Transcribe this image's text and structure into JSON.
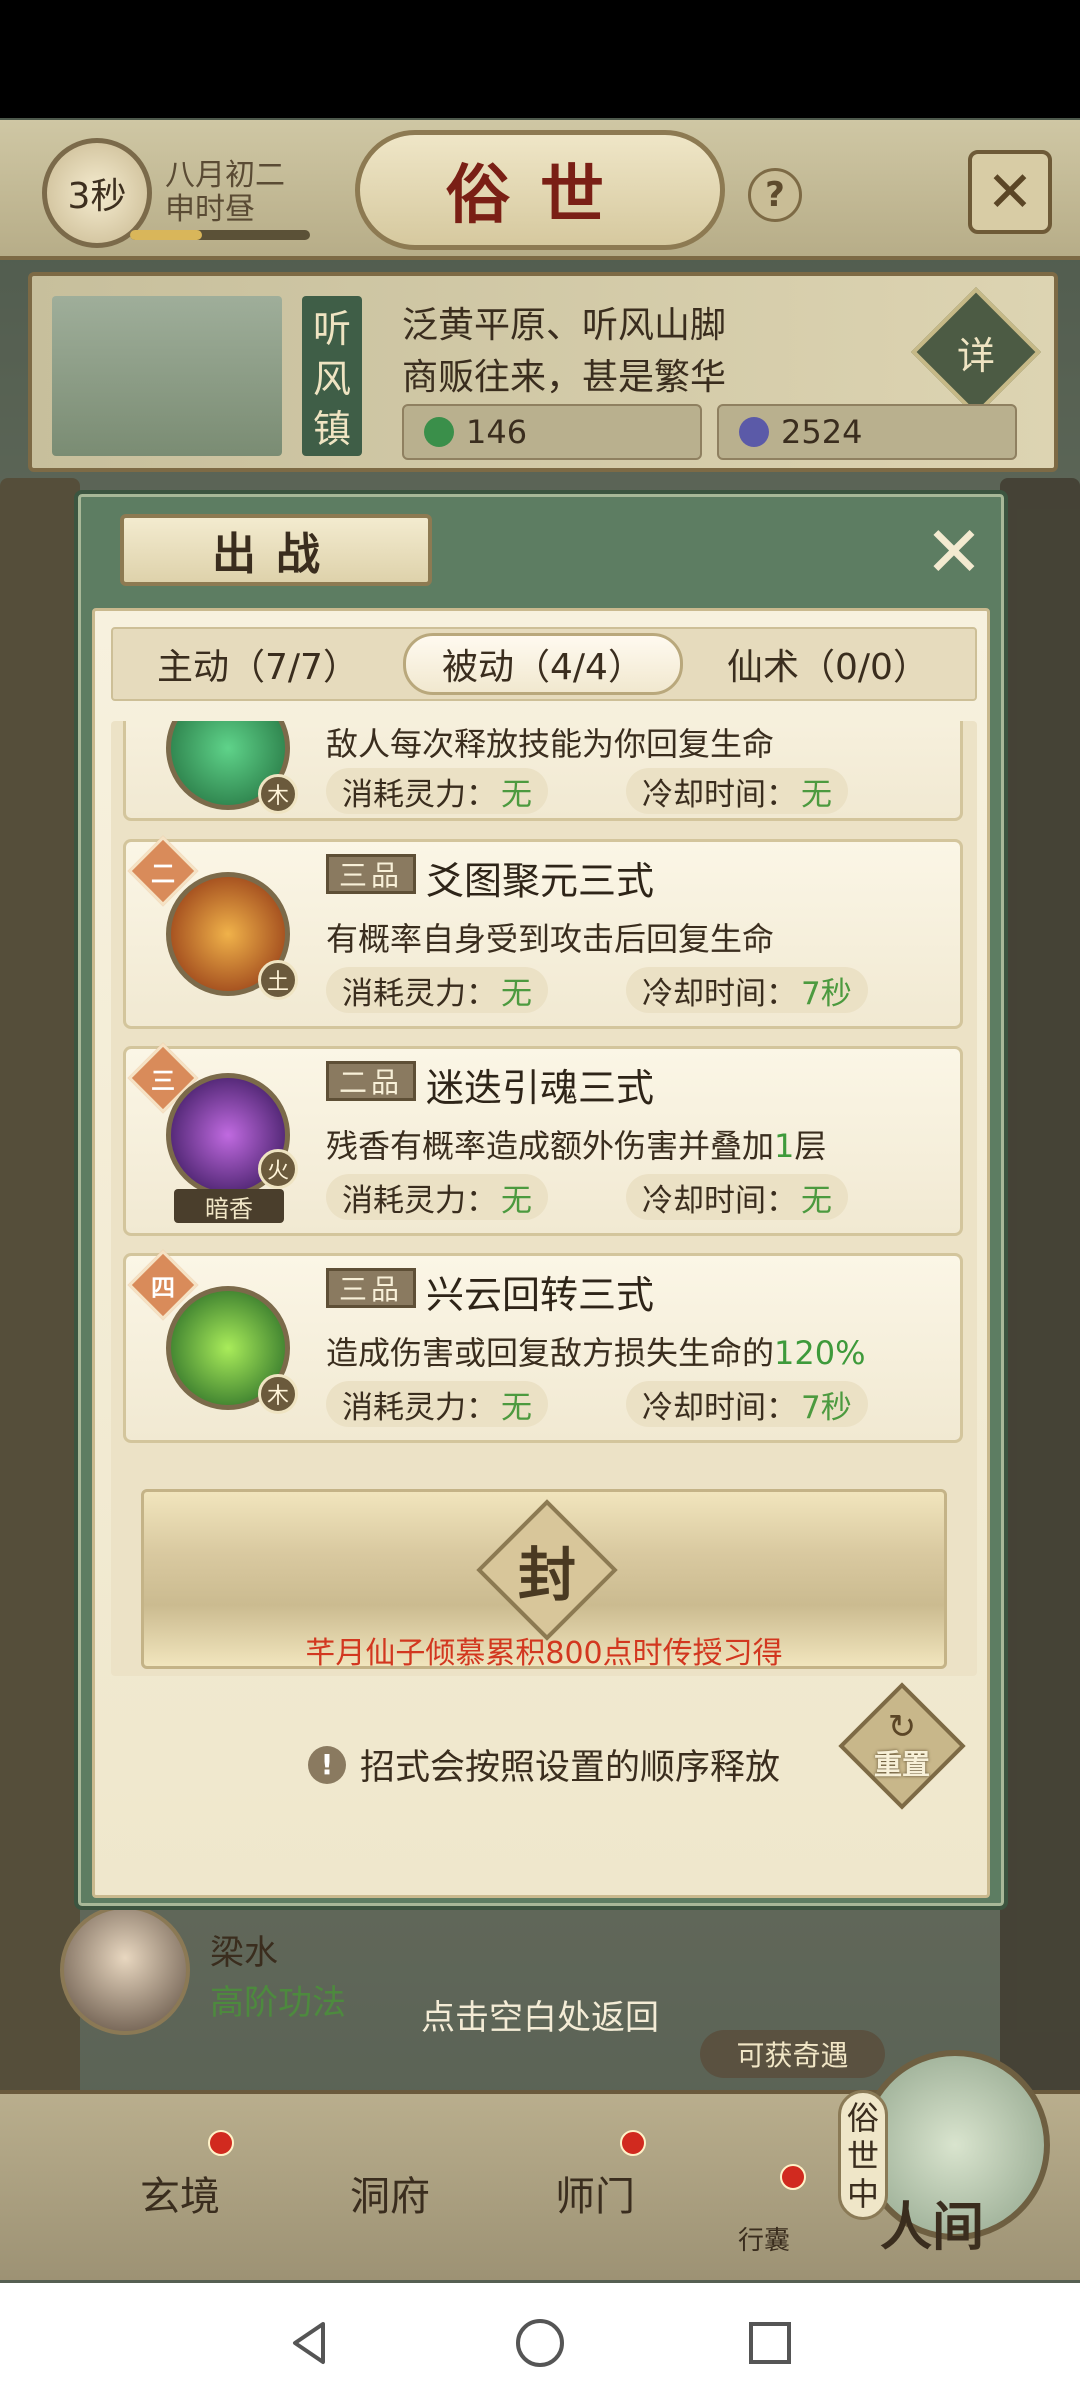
{
  "topbar": {
    "timer": "3秒",
    "date_line1": "八月初二",
    "date_line2": "申时昼",
    "title": "俗世",
    "help": "?",
    "close": "✕"
  },
  "location": {
    "tag": "听风镇",
    "desc_line1": "泛黄平原、听风山脚",
    "desc_line2": "商贩往来，甚是繁华",
    "detail_button": "详",
    "resource1": "146",
    "resource2": "2524"
  },
  "modal": {
    "title": "出战",
    "close": "✕",
    "tabs": [
      {
        "label": "主动（7/7）"
      },
      {
        "label": "被动（4/4）"
      },
      {
        "label": "仙术（0/0）"
      }
    ],
    "stat_labels": {
      "cost": "消耗灵力：",
      "cooldown": "冷却时间："
    },
    "skills": [
      {
        "order": "",
        "grade": "",
        "name": "",
        "desc": "敌人每次释放技能为你回复生命",
        "element": "木",
        "cost": "无",
        "cooldown": "无"
      },
      {
        "order": "二",
        "grade": "三品",
        "name": "爻图聚元三式",
        "desc": "有概率自身受到攻击后回复生命",
        "element": "土",
        "cost": "无",
        "cooldown": "7秒"
      },
      {
        "order": "三",
        "grade": "二品",
        "name": "迷迭引魂三式",
        "desc_prefix": "残香有概率造成额外伤害并叠加",
        "desc_highlight": "1",
        "desc_suffix": "层",
        "element": "火",
        "icon_caption": "暗香",
        "cost": "无",
        "cooldown": "无"
      },
      {
        "order": "四",
        "grade": "三品",
        "name": "兴云回转三式",
        "desc_prefix": "造成伤害或回复敌方损失生命的",
        "desc_highlight": "120%",
        "element": "木",
        "cost": "无",
        "cooldown": "7秒"
      }
    ],
    "sealed": {
      "char": "封",
      "text": "芊月仙子倾慕累积800点时传授习得"
    },
    "hint": "招式会按照设置的顺序释放",
    "hint_icon": "!",
    "reset_label": "重置"
  },
  "background": {
    "char_name": "梁水",
    "char_sub": "高阶功法",
    "tap_return": "点击空白处返回",
    "encounter": "可获奇遇",
    "world_vertical": "俗世中",
    "world_label": "人间",
    "nav": [
      "玄境",
      "洞府",
      "师门",
      "行囊"
    ]
  },
  "colors": {
    "frame_green": "#5d7d62",
    "paper": "#f7f1de",
    "value_green": "#4c9a3f",
    "seal_red": "#d2371f"
  }
}
